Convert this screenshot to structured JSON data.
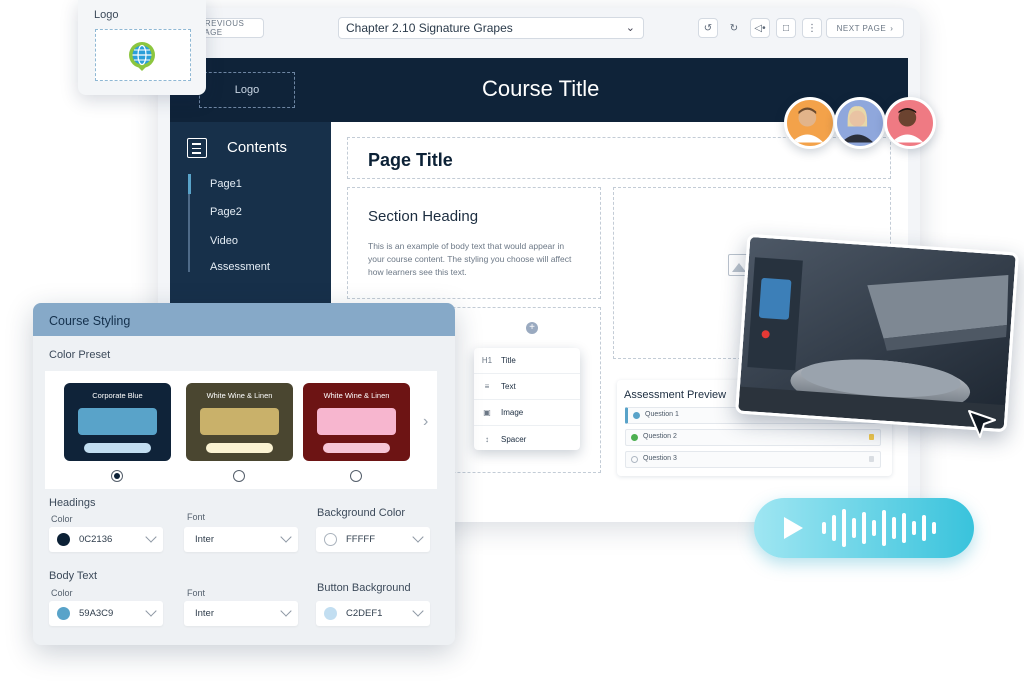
{
  "toolbar": {
    "prev_label": "PREVIOUS PAGE",
    "chapter": "Chapter 2.10  Signature Grapes",
    "next_label": "NEXT PAGE"
  },
  "header": {
    "logo_placeholder": "Logo",
    "course_title": "Course Title"
  },
  "sidebar": {
    "title": "Contents",
    "items": [
      {
        "label": "Page1"
      },
      {
        "label": "Page2"
      },
      {
        "label": "Video"
      },
      {
        "label": "Assessment"
      }
    ]
  },
  "content": {
    "page_title": "Page Title",
    "section_heading": "Section Heading",
    "body_text": "This is an example of body text that would appear in your course content. The styling you choose will affect how learners see this text."
  },
  "insert_menu": {
    "items": [
      {
        "icon": "H1",
        "label": "Title"
      },
      {
        "icon": "text-lines-icon",
        "label": "Text"
      },
      {
        "icon": "image-icon",
        "label": "Image"
      },
      {
        "icon": "spacer-icon",
        "label": "Spacer"
      }
    ]
  },
  "assessment_preview": {
    "title": "Assessment Preview",
    "questions": [
      {
        "label": "Question 1",
        "dot_color": "#59A3C9",
        "flag_color": "#d9dde2"
      },
      {
        "label": "Question 2",
        "dot_color": "#4caf50",
        "flag_color": "#f2c94c"
      },
      {
        "label": "Question 3",
        "dot_color": "#ffffff",
        "flag_color": "#d9dde2"
      }
    ]
  },
  "logo_card": {
    "label": "Logo"
  },
  "course_styling": {
    "title": "Course Styling",
    "color_preset_label": "Color Preset",
    "presets": [
      {
        "name": "Corporate Blue",
        "bg": "#0f2339",
        "bar1": "#59A3C9",
        "bar2": "#C2DEF1",
        "selected": true
      },
      {
        "name": "White Wine & Linen",
        "bg": "#4a4630",
        "bar1": "#c9b16a",
        "bar2": "#fbf3d2",
        "selected": false
      },
      {
        "name": "White Wine & Linen",
        "bg": "#6d1414",
        "bar1": "#f7b6cf",
        "bar2": "#f6c6d6",
        "selected": false
      }
    ],
    "headings": {
      "title": "Headings",
      "color_label": "Color",
      "color_value": "0C2136",
      "color_swatch": "#0C2136",
      "font_label": "Font",
      "font_value": "Inter"
    },
    "background": {
      "title": "Background Color",
      "value": "FFFFF",
      "swatch": "#ffffff"
    },
    "body_text": {
      "title": "Body Text",
      "color_label": "Color",
      "color_value": "59A3C9",
      "color_swatch": "#59A3C9",
      "font_label": "Font",
      "font_value": "Inter"
    },
    "button_background": {
      "title": "Button Background",
      "value": "C2DEF1",
      "swatch": "#C2DEF1"
    }
  }
}
